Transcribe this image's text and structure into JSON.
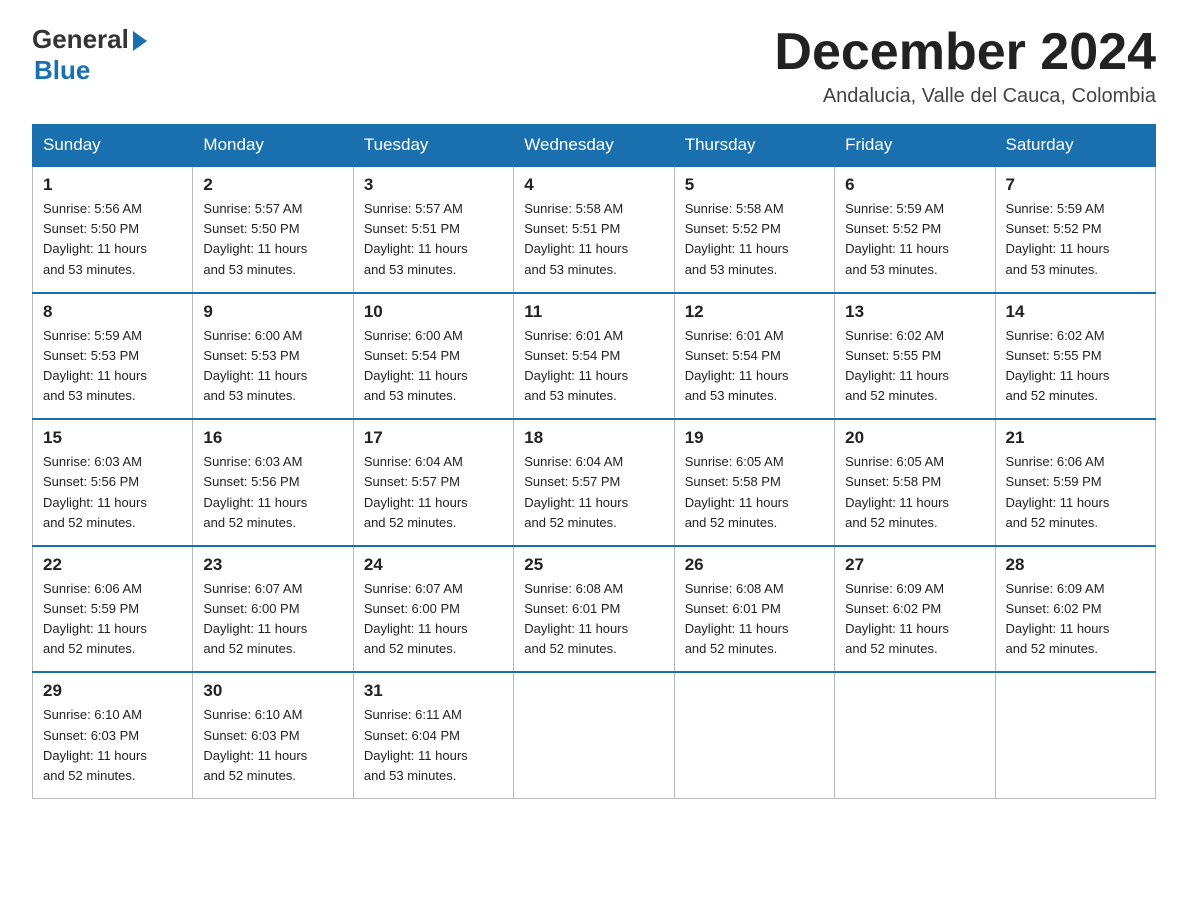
{
  "header": {
    "logo": {
      "general": "General",
      "blue": "Blue"
    },
    "title": "December 2024",
    "location": "Andalucia, Valle del Cauca, Colombia"
  },
  "days_of_week": [
    "Sunday",
    "Monday",
    "Tuesday",
    "Wednesday",
    "Thursday",
    "Friday",
    "Saturday"
  ],
  "weeks": [
    [
      {
        "day": "1",
        "info": "Sunrise: 5:56 AM\nSunset: 5:50 PM\nDaylight: 11 hours\nand 53 minutes."
      },
      {
        "day": "2",
        "info": "Sunrise: 5:57 AM\nSunset: 5:50 PM\nDaylight: 11 hours\nand 53 minutes."
      },
      {
        "day": "3",
        "info": "Sunrise: 5:57 AM\nSunset: 5:51 PM\nDaylight: 11 hours\nand 53 minutes."
      },
      {
        "day": "4",
        "info": "Sunrise: 5:58 AM\nSunset: 5:51 PM\nDaylight: 11 hours\nand 53 minutes."
      },
      {
        "day": "5",
        "info": "Sunrise: 5:58 AM\nSunset: 5:52 PM\nDaylight: 11 hours\nand 53 minutes."
      },
      {
        "day": "6",
        "info": "Sunrise: 5:59 AM\nSunset: 5:52 PM\nDaylight: 11 hours\nand 53 minutes."
      },
      {
        "day": "7",
        "info": "Sunrise: 5:59 AM\nSunset: 5:52 PM\nDaylight: 11 hours\nand 53 minutes."
      }
    ],
    [
      {
        "day": "8",
        "info": "Sunrise: 5:59 AM\nSunset: 5:53 PM\nDaylight: 11 hours\nand 53 minutes."
      },
      {
        "day": "9",
        "info": "Sunrise: 6:00 AM\nSunset: 5:53 PM\nDaylight: 11 hours\nand 53 minutes."
      },
      {
        "day": "10",
        "info": "Sunrise: 6:00 AM\nSunset: 5:54 PM\nDaylight: 11 hours\nand 53 minutes."
      },
      {
        "day": "11",
        "info": "Sunrise: 6:01 AM\nSunset: 5:54 PM\nDaylight: 11 hours\nand 53 minutes."
      },
      {
        "day": "12",
        "info": "Sunrise: 6:01 AM\nSunset: 5:54 PM\nDaylight: 11 hours\nand 53 minutes."
      },
      {
        "day": "13",
        "info": "Sunrise: 6:02 AM\nSunset: 5:55 PM\nDaylight: 11 hours\nand 52 minutes."
      },
      {
        "day": "14",
        "info": "Sunrise: 6:02 AM\nSunset: 5:55 PM\nDaylight: 11 hours\nand 52 minutes."
      }
    ],
    [
      {
        "day": "15",
        "info": "Sunrise: 6:03 AM\nSunset: 5:56 PM\nDaylight: 11 hours\nand 52 minutes."
      },
      {
        "day": "16",
        "info": "Sunrise: 6:03 AM\nSunset: 5:56 PM\nDaylight: 11 hours\nand 52 minutes."
      },
      {
        "day": "17",
        "info": "Sunrise: 6:04 AM\nSunset: 5:57 PM\nDaylight: 11 hours\nand 52 minutes."
      },
      {
        "day": "18",
        "info": "Sunrise: 6:04 AM\nSunset: 5:57 PM\nDaylight: 11 hours\nand 52 minutes."
      },
      {
        "day": "19",
        "info": "Sunrise: 6:05 AM\nSunset: 5:58 PM\nDaylight: 11 hours\nand 52 minutes."
      },
      {
        "day": "20",
        "info": "Sunrise: 6:05 AM\nSunset: 5:58 PM\nDaylight: 11 hours\nand 52 minutes."
      },
      {
        "day": "21",
        "info": "Sunrise: 6:06 AM\nSunset: 5:59 PM\nDaylight: 11 hours\nand 52 minutes."
      }
    ],
    [
      {
        "day": "22",
        "info": "Sunrise: 6:06 AM\nSunset: 5:59 PM\nDaylight: 11 hours\nand 52 minutes."
      },
      {
        "day": "23",
        "info": "Sunrise: 6:07 AM\nSunset: 6:00 PM\nDaylight: 11 hours\nand 52 minutes."
      },
      {
        "day": "24",
        "info": "Sunrise: 6:07 AM\nSunset: 6:00 PM\nDaylight: 11 hours\nand 52 minutes."
      },
      {
        "day": "25",
        "info": "Sunrise: 6:08 AM\nSunset: 6:01 PM\nDaylight: 11 hours\nand 52 minutes."
      },
      {
        "day": "26",
        "info": "Sunrise: 6:08 AM\nSunset: 6:01 PM\nDaylight: 11 hours\nand 52 minutes."
      },
      {
        "day": "27",
        "info": "Sunrise: 6:09 AM\nSunset: 6:02 PM\nDaylight: 11 hours\nand 52 minutes."
      },
      {
        "day": "28",
        "info": "Sunrise: 6:09 AM\nSunset: 6:02 PM\nDaylight: 11 hours\nand 52 minutes."
      }
    ],
    [
      {
        "day": "29",
        "info": "Sunrise: 6:10 AM\nSunset: 6:03 PM\nDaylight: 11 hours\nand 52 minutes."
      },
      {
        "day": "30",
        "info": "Sunrise: 6:10 AM\nSunset: 6:03 PM\nDaylight: 11 hours\nand 52 minutes."
      },
      {
        "day": "31",
        "info": "Sunrise: 6:11 AM\nSunset: 6:04 PM\nDaylight: 11 hours\nand 53 minutes."
      },
      {
        "day": "",
        "info": ""
      },
      {
        "day": "",
        "info": ""
      },
      {
        "day": "",
        "info": ""
      },
      {
        "day": "",
        "info": ""
      }
    ]
  ]
}
